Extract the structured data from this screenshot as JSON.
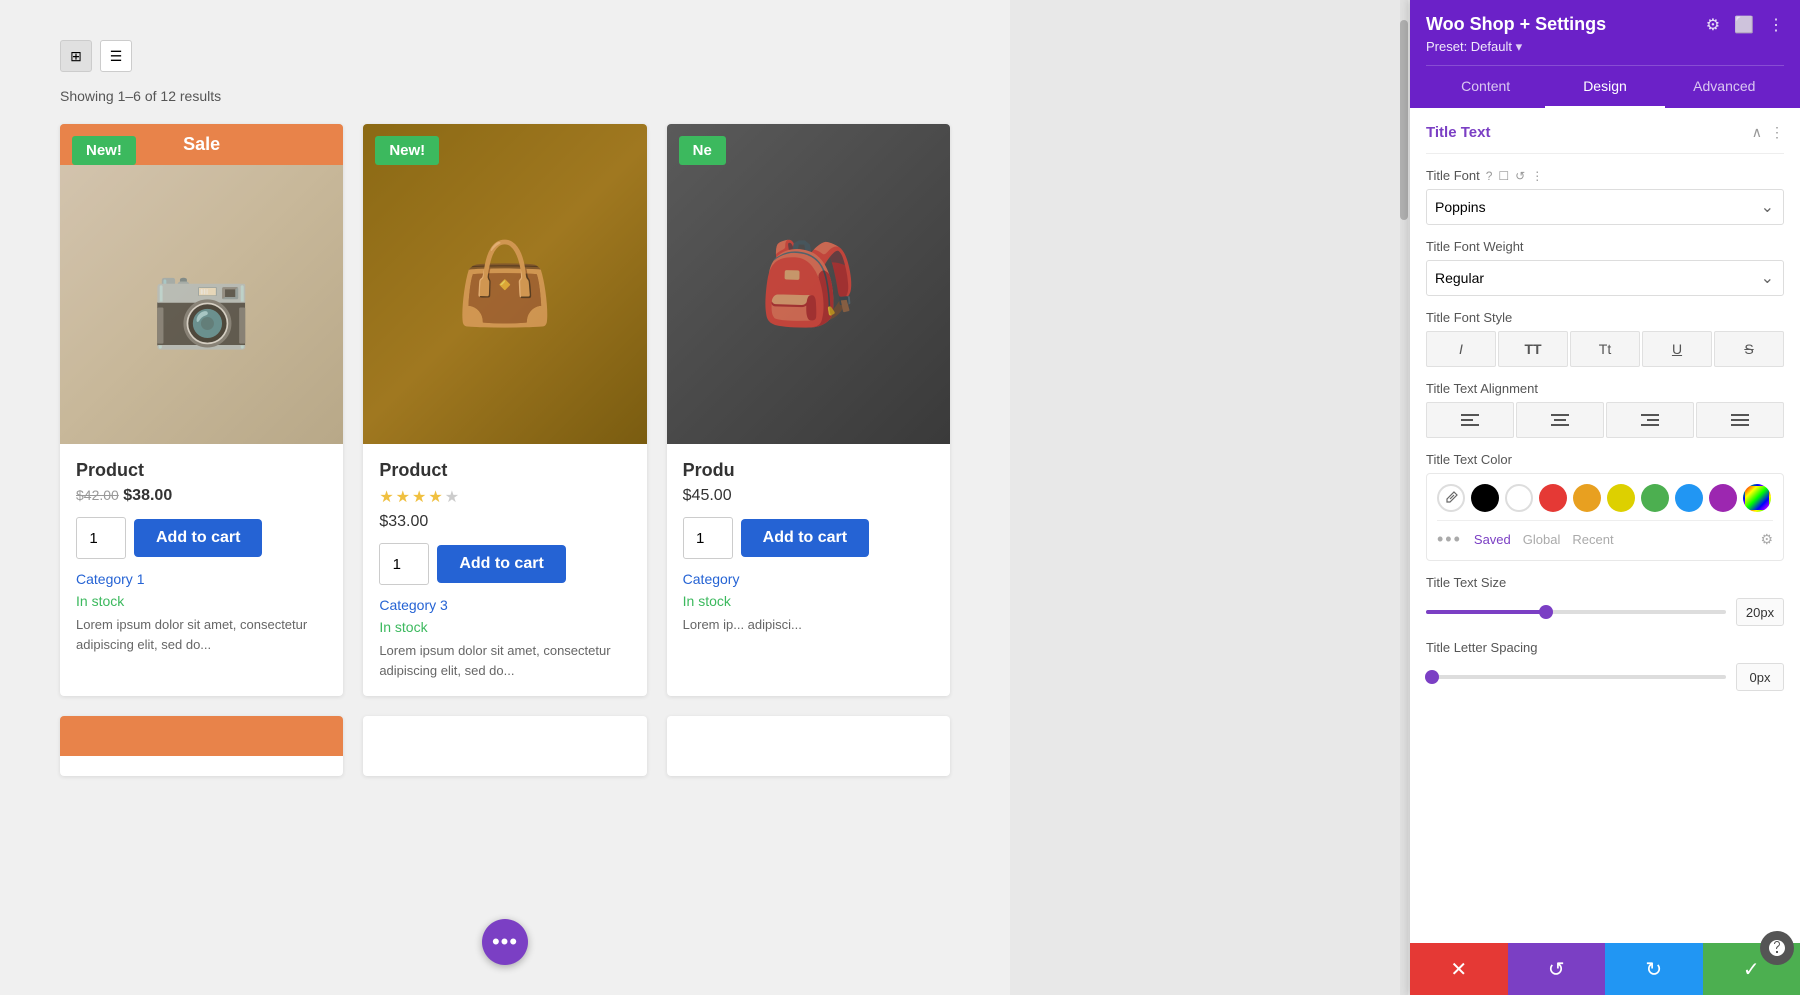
{
  "panel": {
    "title": "Woo Shop + Settings",
    "preset_label": "Preset: Default",
    "tabs": [
      {
        "id": "content",
        "label": "Content"
      },
      {
        "id": "design",
        "label": "Design",
        "active": true
      },
      {
        "id": "advanced",
        "label": "Advanced"
      }
    ],
    "header_icons": [
      "⚙",
      "⬜",
      "⋮"
    ]
  },
  "section": {
    "title": "Title Text",
    "collapse_icon": "^",
    "more_icon": "⋮"
  },
  "settings": {
    "title_font_label": "Title Font",
    "title_font_value": "Poppins",
    "title_font_icons": [
      "?",
      "☐",
      "↺",
      "⋮"
    ],
    "title_font_weight_label": "Title Font Weight",
    "title_font_weight_value": "Regular",
    "title_font_style_label": "Title Font Style",
    "font_style_buttons": [
      {
        "label": "I",
        "style": "italic",
        "id": "italic"
      },
      {
        "label": "TT",
        "style": "uppercase",
        "id": "uppercase"
      },
      {
        "label": "Tt",
        "style": "capitalize",
        "id": "capitalize"
      },
      {
        "label": "U",
        "style": "underline",
        "id": "underline"
      },
      {
        "label": "S",
        "style": "strikethrough",
        "id": "strikethrough"
      }
    ],
    "title_text_alignment_label": "Title Text Alignment",
    "alignment_buttons": [
      {
        "icon": "≡",
        "id": "left"
      },
      {
        "icon": "≡",
        "id": "center"
      },
      {
        "icon": "≡",
        "id": "right"
      },
      {
        "icon": "≡",
        "id": "justify"
      }
    ],
    "title_text_color_label": "Title Text Color",
    "colors": [
      {
        "id": "eyedropper",
        "type": "eyedropper"
      },
      {
        "id": "black",
        "hex": "#000000"
      },
      {
        "id": "white",
        "hex": "#ffffff"
      },
      {
        "id": "red",
        "hex": "#e53935"
      },
      {
        "id": "orange",
        "hex": "#e8a020"
      },
      {
        "id": "yellow",
        "hex": "#ddd000"
      },
      {
        "id": "green",
        "hex": "#4caf50"
      },
      {
        "id": "blue",
        "hex": "#2196f3"
      },
      {
        "id": "purple",
        "hex": "#9c27b0"
      },
      {
        "id": "gradient",
        "type": "gradient"
      }
    ],
    "color_tabs": [
      "Saved",
      "Global",
      "Recent"
    ],
    "title_text_size_label": "Title Text Size",
    "title_text_size_value": "20px",
    "title_text_size_percent": 40,
    "title_letter_spacing_label": "Title Letter Spacing",
    "title_letter_spacing_value": "0px",
    "title_letter_spacing_percent": 0
  },
  "shop": {
    "results_text": "Showing 1–6 of 12 results",
    "products": [
      {
        "id": 1,
        "title": "Product",
        "has_sale_banner": true,
        "sale_banner_text": "Sale",
        "has_new_badge": true,
        "new_badge_text": "New!",
        "price_original": "$42.00",
        "price_sale": "$38.00",
        "has_stars": false,
        "qty": "1",
        "add_to_cart": "Add to cart",
        "category": "Category 1",
        "stock": "In stock",
        "description": "Lorem ipsum dolor sit amet, consectetur adipiscing elit, sed do..."
      },
      {
        "id": 2,
        "title": "Product",
        "has_sale_banner": false,
        "has_new_badge": true,
        "new_badge_text": "New!",
        "price_regular": "$33.00",
        "has_stars": true,
        "stars_filled": 4,
        "stars_total": 5,
        "qty": "1",
        "add_to_cart": "Add to cart",
        "category": "Category 3",
        "stock": "In stock",
        "description": "Lorem ipsum dolor sit amet, consectetur adipiscing elit, sed do..."
      },
      {
        "id": 3,
        "title": "Produ",
        "has_sale_banner": false,
        "has_new_badge": true,
        "new_badge_text": "Ne",
        "price_regular": "$45.00",
        "has_stars": false,
        "qty": "1",
        "add_to_cart": "Add to cart",
        "category": "Category",
        "stock": "In stock",
        "description": "Lorem ip... adipisci..."
      }
    ]
  },
  "bottom_bar": {
    "cancel_icon": "✕",
    "undo_icon": "↺",
    "redo_icon": "↻",
    "save_icon": "✓"
  },
  "fab": {
    "icon": "•••"
  }
}
